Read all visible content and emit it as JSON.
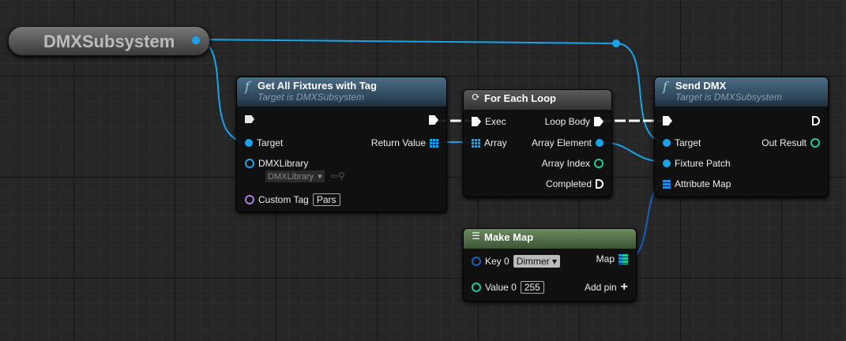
{
  "subsystem": "DMXSubsystem",
  "get_fixtures": {
    "title": "Get All Fixtures with Tag",
    "subtitle": "Target is DMXSubsystem",
    "target": "Target",
    "return": "Return Value",
    "library": "DMXLibrary",
    "library_value": "DMXLibrary",
    "tag": "Custom Tag",
    "tag_value": "Pars"
  },
  "loop": {
    "title": "For Each Loop",
    "exec": "Exec",
    "array": "Array",
    "body": "Loop Body",
    "element": "Array Element",
    "index": "Array Index",
    "completed": "Completed"
  },
  "send": {
    "title": "Send DMX",
    "subtitle": "Target is DMXSubsystem",
    "target": "Target",
    "patch": "Fixture Patch",
    "attr": "Attribute Map",
    "result": "Out Result"
  },
  "makemap": {
    "title": "Make Map",
    "key": "Key 0",
    "key_value": "Dimmer",
    "value": "Value 0",
    "value_value": "255",
    "map": "Map",
    "add": "Add pin"
  },
  "colors": {
    "object": "#1aa3e8",
    "exec": "#ffffff",
    "struct": "#1d5fb8",
    "int": "#1fc9a0",
    "name": "#b27de0"
  }
}
